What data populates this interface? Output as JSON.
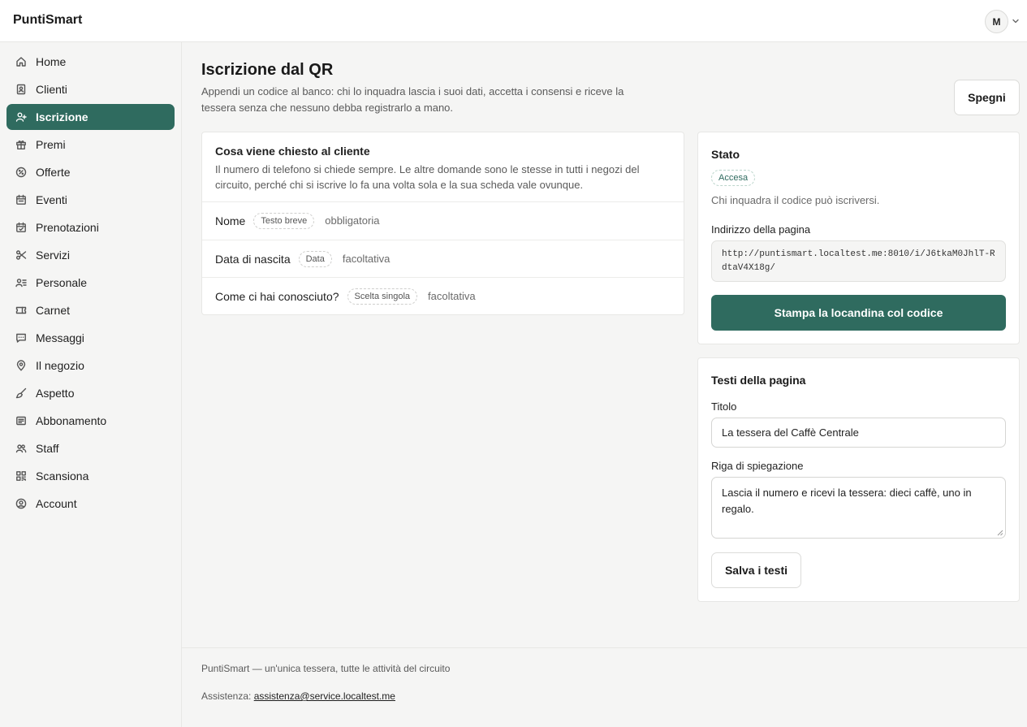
{
  "app": {
    "brand": "PuntiSmart",
    "avatar_initial": "M"
  },
  "sidebar": {
    "items": [
      {
        "label": "Home",
        "icon": "home-icon"
      },
      {
        "label": "Clienti",
        "icon": "address-book-icon"
      },
      {
        "label": "Iscrizione",
        "icon": "user-plus-icon",
        "active": true
      },
      {
        "label": "Premi",
        "icon": "gift-icon"
      },
      {
        "label": "Offerte",
        "icon": "badge-percent-icon"
      },
      {
        "label": "Eventi",
        "icon": "calendar-icon"
      },
      {
        "label": "Prenotazioni",
        "icon": "calendar-check-icon"
      },
      {
        "label": "Servizi",
        "icon": "scissors-icon"
      },
      {
        "label": "Personale",
        "icon": "user-list-icon"
      },
      {
        "label": "Carnet",
        "icon": "ticket-icon"
      },
      {
        "label": "Messaggi",
        "icon": "message-icon"
      },
      {
        "label": "Il negozio",
        "icon": "map-pin-icon"
      },
      {
        "label": "Aspetto",
        "icon": "brush-icon"
      },
      {
        "label": "Abbonamento",
        "icon": "receipt-icon"
      },
      {
        "label": "Staff",
        "icon": "users-icon"
      },
      {
        "label": "Scansiona",
        "icon": "qr-code-icon"
      },
      {
        "label": "Account",
        "icon": "user-circle-icon"
      }
    ]
  },
  "page": {
    "title": "Iscrizione dal QR",
    "description": "Appendi un codice al banco: chi lo inquadra lascia i suoi dati, accetta i consensi e riceve la tessera senza che nessuno debba registrarlo a mano.",
    "off_button": "Spegni"
  },
  "questions_card": {
    "title": "Cosa viene chiesto al cliente",
    "description": "Il numero di telefono si chiede sempre. Le altre domande sono le stesse in tutti i negozi del circuito, perché chi si iscrive lo fa una volta sola e la sua scheda vale ovunque.",
    "rows": [
      {
        "label": "Nome",
        "type": "Testo breve",
        "requirement": "obbligatoria"
      },
      {
        "label": "Data di nascita",
        "type": "Data",
        "requirement": "facoltativa"
      },
      {
        "label": "Come ci hai conosciuto?",
        "type": "Scelta singola",
        "requirement": "facoltativa"
      }
    ]
  },
  "status_card": {
    "title": "Stato",
    "status": "Accesa",
    "status_note": "Chi inquadra il codice può iscriversi.",
    "address_label": "Indirizzo della pagina",
    "address_value": "http://puntismart.localtest.me:8010/i/J6tkaM0JhlT-RdtaV4X18g/",
    "print_button": "Stampa la locandina col codice"
  },
  "texts_card": {
    "title": "Testi della pagina",
    "title_label": "Titolo",
    "title_value": "La tessera del Caffè Centrale",
    "subtitle_label": "Riga di spiegazione",
    "subtitle_value": "Lascia il numero e ricevi la tessera: dieci caffè, uno in regalo.",
    "save_button": "Salva i testi"
  },
  "footer": {
    "tagline": "PuntiSmart — un'unica tessera, tutte le attività del circuito",
    "support_label": "Assistenza:",
    "support_email": "assistenza@service.localtest.me"
  },
  "colors": {
    "accent": "#2f6b5f",
    "status_text": "#2f6b5f",
    "background": "#f5f5f4"
  }
}
